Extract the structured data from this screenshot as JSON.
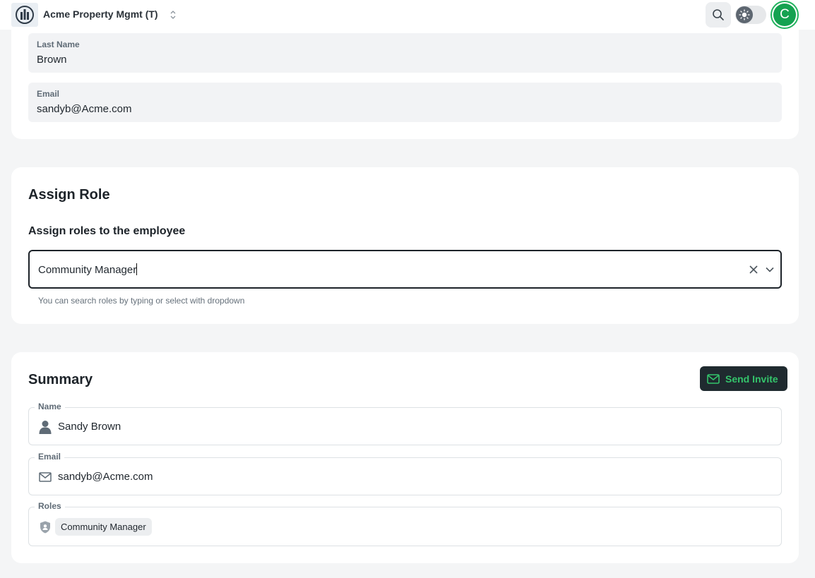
{
  "header": {
    "org_name": "Acme Property Mgmt (T)",
    "avatar_initial": "C",
    "accent_color": "#15a251"
  },
  "employee_details": {
    "last_name_label": "Last Name",
    "last_name_value": "Brown",
    "email_label": "Email",
    "email_value": "sandyb@Acme.com"
  },
  "assign_role": {
    "title": "Assign Role",
    "subtitle": "Assign roles to the employee",
    "selected_role": "Community Manager",
    "helper_text": "You can search roles by typing or select with dropdown"
  },
  "summary": {
    "title": "Summary",
    "send_invite_label": "Send Invite",
    "name_label": "Name",
    "name_value": "Sandy Brown",
    "email_label": "Email",
    "email_value": "sandyb@Acme.com",
    "roles_label": "Roles",
    "roles": [
      "Community Manager"
    ]
  }
}
